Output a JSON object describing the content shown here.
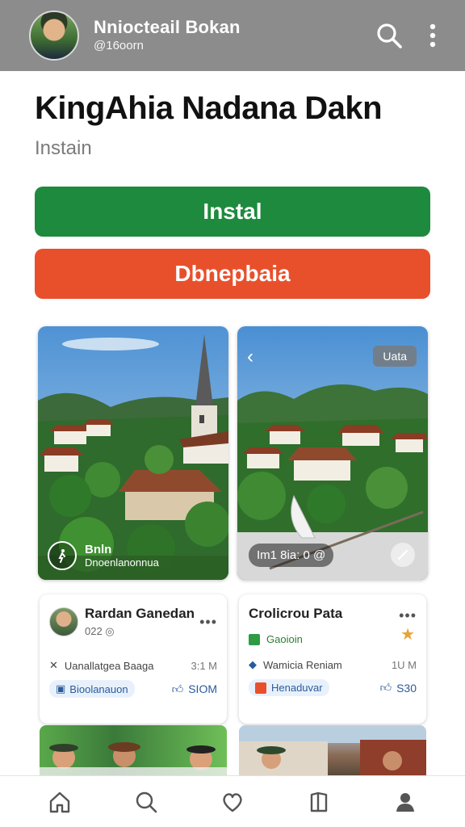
{
  "header": {
    "title": "Nniocteail Bokan",
    "subtitle": "@16oorn",
    "icons": [
      "search-icon",
      "more-vertical-icon"
    ]
  },
  "app": {
    "title": "KingAhia Nadana Dakn",
    "subtitle": "Instain"
  },
  "buttons": {
    "install": "Instal",
    "secondary": "Dbnepbaia"
  },
  "screenshots": [
    {
      "overlay_title": "Bnln",
      "overlay_sub": "Dnoenlanonnua"
    },
    {
      "badge": "Uata",
      "pill": "Im1 8ia: 0 @"
    }
  ],
  "cards": [
    {
      "name": "Rardan Ganedan",
      "meta": "022 ◎",
      "row_text": "Uanallatgea Baaga",
      "row_right": "3:1 M",
      "tag": "Bioolanauon",
      "likes": "SIOM"
    },
    {
      "name": "Crolicrou Pata",
      "meta": "Gaoioin",
      "row_text": "Wamicia Reniam",
      "row_right": "1U M",
      "tag": "Henaduvar",
      "likes": "S30"
    }
  ],
  "nav": [
    "home-icon",
    "search-icon",
    "heart-icon",
    "library-icon",
    "profile-icon"
  ],
  "colors": {
    "topbar": "#8c8c8c",
    "install": "#1e8a3e",
    "secondary": "#e8502c"
  }
}
